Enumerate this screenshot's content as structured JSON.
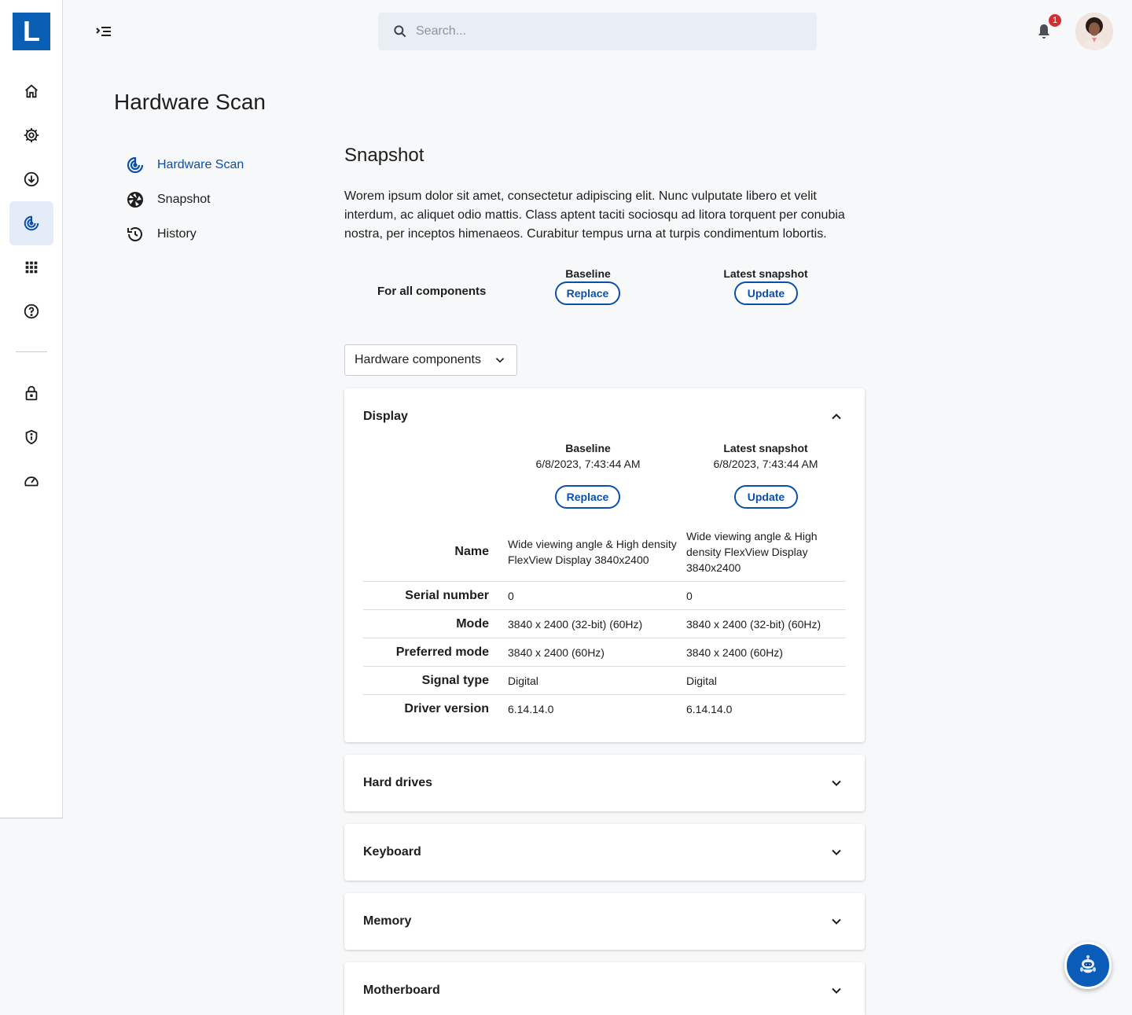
{
  "brand": {
    "logo_letter": "L",
    "accent": "#0b4fa8",
    "logo_bg": "#0a5fb4"
  },
  "rail": {
    "items": [
      {
        "icon": "home-icon"
      },
      {
        "icon": "gear-icon"
      },
      {
        "icon": "download-icon"
      },
      {
        "icon": "hardware-scan-icon",
        "active": true
      },
      {
        "icon": "apps-grid-icon"
      },
      {
        "icon": "help-icon"
      },
      {
        "icon": "lock-icon"
      },
      {
        "icon": "shield-icon"
      },
      {
        "icon": "speedometer-icon"
      }
    ]
  },
  "header": {
    "search_placeholder": "Search...",
    "notification_count": "1"
  },
  "page": {
    "title": "Hardware Scan"
  },
  "subnav": {
    "items": [
      {
        "label": "Hardware Scan",
        "icon": "hardware-scan-icon",
        "active": true
      },
      {
        "label": "Snapshot",
        "icon": "aperture-icon"
      },
      {
        "label": "History",
        "icon": "history-icon"
      }
    ]
  },
  "snapshot": {
    "title": "Snapshot",
    "description": "Worem ipsum dolor sit amet, consectetur adipiscing elit. Nunc vulputate libero et velit interdum, ac aliquet odio mattis. Class aptent taciti sociosqu ad litora torquent per conubia nostra, per inceptos himenaeos. Curabitur tempus urna at turpis condimentum lobortis.",
    "all_components_label": "For all components",
    "baseline_label": "Baseline",
    "latest_label": "Latest snapshot",
    "replace_label": "Replace",
    "update_label": "Update",
    "dropdown_value": "Hardware components"
  },
  "display": {
    "title": "Display",
    "baseline_label": "Baseline",
    "baseline_date": "6/8/2023, 7:43:44 AM",
    "latest_label": "Latest snapshot",
    "latest_date": "6/8/2023, 7:43:44 AM",
    "replace_label": "Replace",
    "update_label": "Update",
    "rows": [
      {
        "key": "Name",
        "baseline": "Wide viewing angle & High density FlexView Display 3840x2400",
        "latest": "Wide viewing angle & High density FlexView Display 3840x2400"
      },
      {
        "key": "Serial number",
        "baseline": "0",
        "latest": "0"
      },
      {
        "key": "Mode",
        "baseline": "3840 x 2400 (32-bit) (60Hz)",
        "latest": "3840 x 2400 (32-bit) (60Hz)"
      },
      {
        "key": "Preferred mode",
        "baseline": "3840 x 2400 (60Hz)",
        "latest": "3840 x 2400 (60Hz)"
      },
      {
        "key": "Signal type",
        "baseline": "Digital",
        "latest": "Digital"
      },
      {
        "key": "Driver version",
        "baseline": "6.14.14.0",
        "latest": "6.14.14.0"
      }
    ]
  },
  "collapsed_sections": [
    {
      "title": "Hard drives"
    },
    {
      "title": "Keyboard"
    },
    {
      "title": "Memory"
    },
    {
      "title": "Motherboard"
    }
  ]
}
